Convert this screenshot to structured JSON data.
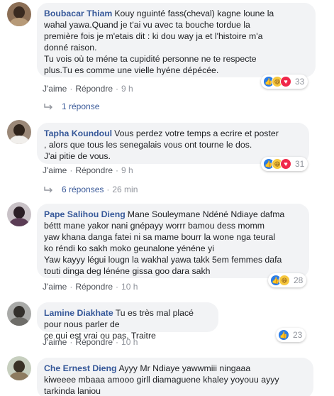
{
  "comments": [
    {
      "author": "Boubacar Thiam",
      "text": "Kouy nguinté fass(cheval) kagne loune la\nwahal yawa.Quand je t'ai vu avec ta bouche tordue la\npremière fois je m'etais dit : ki dou way ja et l'histoire m'a\ndonné raison.\nTu vois où te méne ta cupidité personne ne te respecte\nplus.Tu es comme une vielle hyéne dépécée.",
      "like_label": "J'aime",
      "reply_label": "Répondre",
      "time": "9 h",
      "reaction_count": "33",
      "reactions": [
        "like-icon",
        "haha-icon",
        "love-icon"
      ],
      "replies_label": "1 réponse",
      "replies_time": ""
    },
    {
      "author": "Tapha Koundoul",
      "text": "Vous perdez votre temps a ecrire et poster\n, alors que tous les senegalais vous ont tourne le dos.\nJ'ai pitie de vous.",
      "like_label": "J'aime",
      "reply_label": "Répondre",
      "time": "9 h",
      "reaction_count": "31",
      "reactions": [
        "like-icon",
        "haha-icon",
        "love-icon"
      ],
      "replies_label": "6 réponses",
      "replies_time": "26 min"
    },
    {
      "author": "Pape Salihou Dieng",
      "text": "Mane Souleymane Ndéné Ndiaye dafma\nbéttt mane yakor nani gnépayy worrr bamou dess momm\nyaw khana danga fatei ni sa mame bourr la wone nga teural\nko réndi ko sakh moko geunalone yénéne yi\nYaw kayyy légui lougn la wakhal yawa takk 5em femmes dafa\ntouti dinga deg lénéne gissa goo dara sakh",
      "like_label": "J'aime",
      "reply_label": "Répondre",
      "time": "10 h",
      "reaction_count": "28",
      "reactions": [
        "like-icon",
        "haha-icon"
      ]
    },
    {
      "author": "Lamine Diakhate",
      "text": "Tu es très mal placé pour nous parler de\nce qui est vrai ou pas. Traitre",
      "like_label": "J'aime",
      "reply_label": "Répondre",
      "time": "10 h",
      "reaction_count": "23",
      "reactions": [
        "like-icon"
      ]
    },
    {
      "author": "Che Ernest Dieng",
      "text": "Ayyy Mr Ndiaye yawwmiii ningaaa\nkiweeee mbaaa amooo girll diamaguene khaley yoyouu ayyy\ntarkinda laniou"
    }
  ],
  "colors": {
    "author_link": "#365899",
    "bubble_bg": "#f2f3f5",
    "meta_text": "#90949c",
    "like_blue": "#2a7ce6",
    "haha_yellow": "#f7c83e",
    "love_red": "#f0284a"
  }
}
